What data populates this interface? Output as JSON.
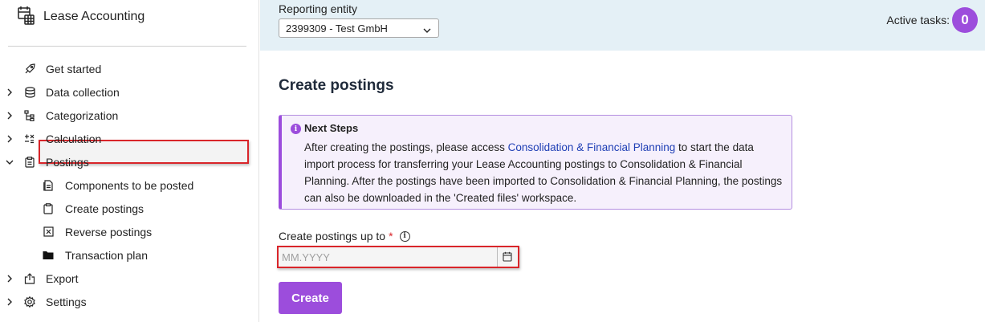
{
  "app": {
    "title": "Lease Accounting"
  },
  "sidebar": {
    "items": [
      {
        "label": "Get started",
        "icon": "rocket-icon",
        "chevron": false
      },
      {
        "label": "Data collection",
        "icon": "database-icon",
        "chevron": true
      },
      {
        "label": "Categorization",
        "icon": "hierarchy-icon",
        "chevron": true
      },
      {
        "label": "Calculation",
        "icon": "calculator-icon",
        "chevron": true
      },
      {
        "label": "Postings",
        "icon": "clipboard-icon",
        "chevron": true,
        "expanded": true
      },
      {
        "label": "Components to be posted",
        "icon": "document-icon",
        "sub": true
      },
      {
        "label": "Create postings",
        "icon": "clipboard-icon",
        "sub": true,
        "selected": true
      },
      {
        "label": "Reverse postings",
        "icon": "close-box-icon",
        "sub": true
      },
      {
        "label": "Transaction plan",
        "icon": "folder-icon",
        "sub": true
      },
      {
        "label": "Export",
        "icon": "export-icon",
        "chevron": true
      },
      {
        "label": "Settings",
        "icon": "gear-icon",
        "chevron": true
      }
    ]
  },
  "topbar": {
    "reporting_entity_label": "Reporting entity",
    "reporting_entity_value": "2399309 - Test GmbH",
    "active_tasks_label": "Active tasks:",
    "active_tasks_count": "0"
  },
  "main": {
    "title": "Create postings",
    "callout": {
      "title": "Next Steps",
      "body_before": "After creating the postings, please access ",
      "link": "Consolidation & Financial Planning",
      "body_after": " to start the data import process for transferring your Lease Accounting postings to Consolidation & Financial Planning. After the postings have been imported to Consolidation & Financial Planning, the postings can also be downloaded in the 'Created files' workspace."
    },
    "field": {
      "label": "Create postings up to",
      "required_mark": "*",
      "placeholder": "MM.YYYY",
      "value": ""
    },
    "create_button": "Create"
  },
  "colors": {
    "accent": "#9c4ddc",
    "topbar_bg": "#e4f0f6",
    "highlight_border": "#d9252a",
    "link": "#1f3fb5"
  }
}
